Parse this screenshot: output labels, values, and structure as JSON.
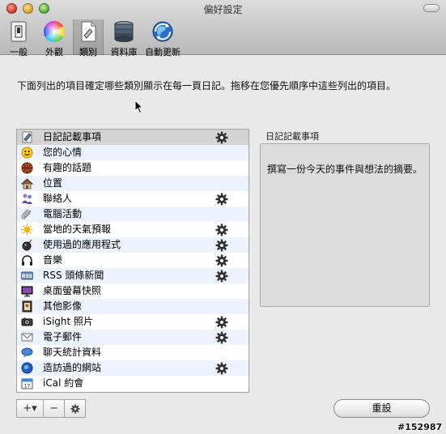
{
  "window": {
    "title": "偏好設定"
  },
  "toolbar": [
    {
      "label": "一般",
      "icon": "switch-icon"
    },
    {
      "label": "外觀",
      "icon": "color-wheel-icon"
    },
    {
      "label": "類別",
      "icon": "document-icon",
      "selected": true
    },
    {
      "label": "資料庫",
      "icon": "database-icon"
    },
    {
      "label": "自動更新",
      "icon": "globe-refresh-icon"
    }
  ],
  "description": "下面列出的項目確定哪些類別顯示在每一頁日記。拖移在您優先順序中這些列出的項目。",
  "categories": [
    {
      "label": "日記記載事項",
      "icon": "journal-icon",
      "gear": true,
      "selected": true
    },
    {
      "label": "您的心情",
      "icon": "smiley-icon",
      "gear": false
    },
    {
      "label": "有趣的話題",
      "icon": "basketball-icon",
      "gear": false
    },
    {
      "label": "位置",
      "icon": "house-icon",
      "gear": false
    },
    {
      "label": "聯絡人",
      "icon": "people-icon",
      "gear": true
    },
    {
      "label": "電腦活動",
      "icon": "paperclip-icon",
      "gear": false
    },
    {
      "label": "當地的天氣預報",
      "icon": "sun-icon",
      "gear": true
    },
    {
      "label": "使用過的應用程式",
      "icon": "bomb-icon",
      "gear": true
    },
    {
      "label": "音樂",
      "icon": "headphones-icon",
      "gear": true
    },
    {
      "label": "RSS 頭條新聞",
      "icon": "rss-icon",
      "gear": true
    },
    {
      "label": "桌面螢幕快照",
      "icon": "monitor-icon",
      "gear": false
    },
    {
      "label": "其他影像",
      "icon": "picture-frame-icon",
      "gear": false
    },
    {
      "label": "iSight 照片",
      "icon": "camera-icon",
      "gear": true
    },
    {
      "label": "電子郵件",
      "icon": "envelope-icon",
      "gear": true
    },
    {
      "label": "聊天統計資料",
      "icon": "chat-bubble-icon",
      "gear": false
    },
    {
      "label": "造訪過的網站",
      "icon": "globe-icon",
      "gear": true
    },
    {
      "label": "iCal 約會",
      "icon": "calendar-icon",
      "gear": false
    }
  ],
  "list_buttons": {
    "add": "+▾",
    "remove": "−",
    "action_icon": "gear-icon"
  },
  "detail": {
    "label": "日記記載事項",
    "text": "撰寫一份今天的事件與想法的摘要。"
  },
  "reset_label": "重設",
  "watermark": "#152987"
}
